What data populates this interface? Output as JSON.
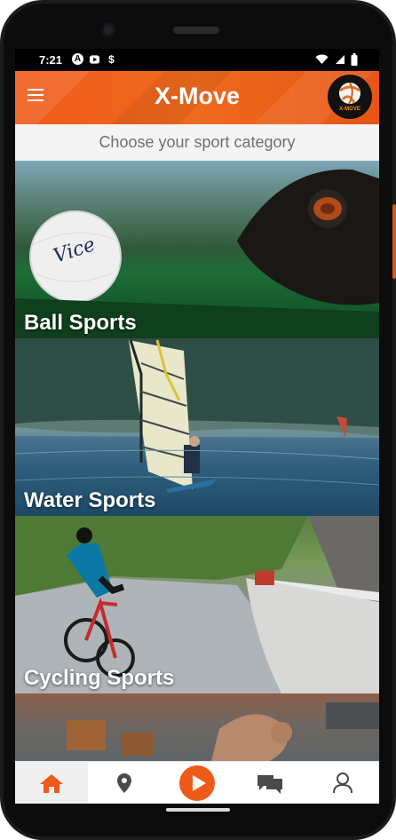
{
  "status_bar": {
    "time": "7:21",
    "left_icons": [
      "automation-icon",
      "youtube-icon",
      "dollar-icon"
    ],
    "right_icons": [
      "wifi-icon",
      "signal-icon",
      "battery-icon"
    ]
  },
  "app_bar": {
    "title": "X-Move",
    "logo_text": "X-MOVE"
  },
  "subheader": {
    "text": "Choose your sport category"
  },
  "categories": [
    {
      "label": "Ball Sports"
    },
    {
      "label": "Water Sports"
    },
    {
      "label": "Cycling Sports"
    },
    {
      "label": ""
    }
  ],
  "bottom_nav": [
    {
      "name": "home",
      "icon": "home-icon",
      "active": true
    },
    {
      "name": "map",
      "icon": "map-pin-icon",
      "active": false
    },
    {
      "name": "play",
      "icon": "play-icon",
      "active": false
    },
    {
      "name": "chat",
      "icon": "chat-icon",
      "active": false
    },
    {
      "name": "profile",
      "icon": "user-icon",
      "active": false
    }
  ],
  "colors": {
    "accent": "#ee5a18",
    "text_secondary": "#6f6f6f",
    "nav_active_bg": "#efefef",
    "icon_gray": "#4a4a4a"
  }
}
